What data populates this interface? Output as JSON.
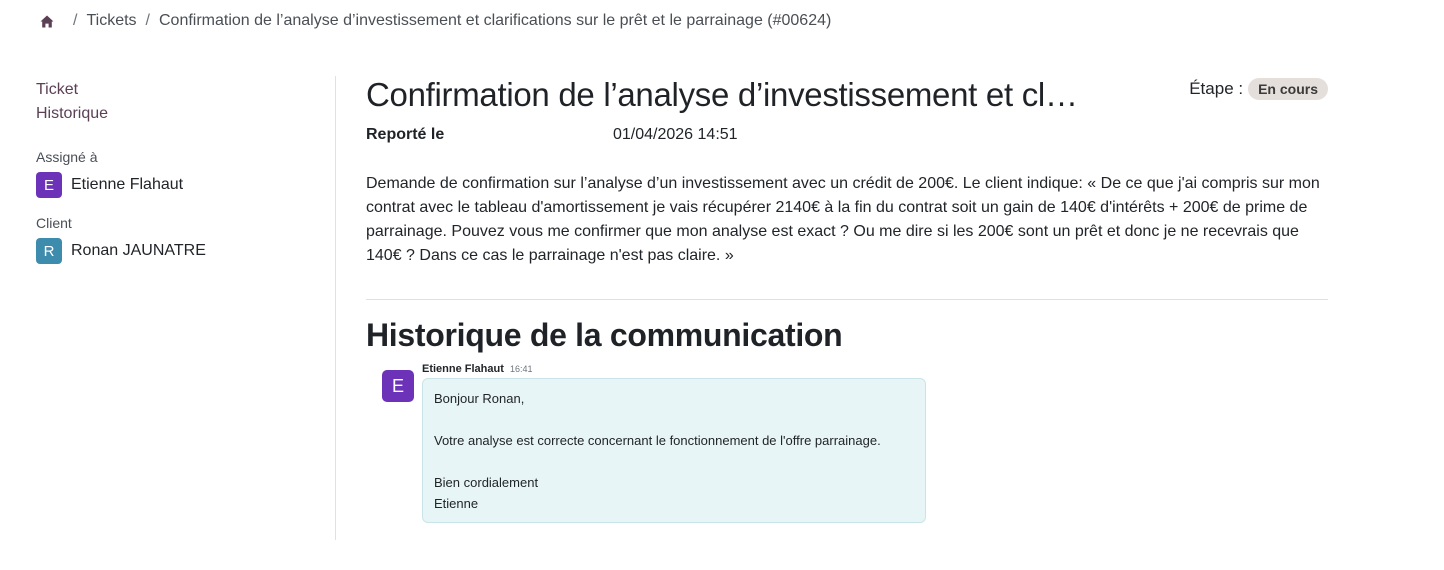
{
  "breadcrumb": {
    "home_icon": "home-icon",
    "separator": "/",
    "tickets": "Tickets",
    "current": "Confirmation de l’analyse d’investissement et clarifications sur le prêt et le parrainage (#00624)"
  },
  "sidebar": {
    "nav": [
      "Ticket",
      "Historique"
    ],
    "assigned_label": "Assigné à",
    "assigned": {
      "initial": "E",
      "name": "Etienne Flahaut"
    },
    "client_label": "Client",
    "client": {
      "initial": "R",
      "name": "Ronan JAUNATRE"
    }
  },
  "ticket": {
    "title": "Confirmation de l’analyse d’investissement et clarifications sur le prêt et le parrainage",
    "stage_label": "Étape :",
    "stage": "En cours",
    "reported_label": "Reporté le",
    "reported_value": "01/04/2026 14:51",
    "description": "Demande de confirmation sur l’analyse d’un investissement avec un crédit de 200€. Le client indique: « De ce que j'ai compris sur mon contrat avec le tableau d'amortissement je vais récupérer 2140€ à la fin du contrat soit un gain   de 140€ d'intérêts + 200€ de prime de parrainage. Pouvez vous me confirmer que mon analyse est exact ? Ou me dire si les 200€ sont un prêt et donc je ne recevrais que 140€ ? Dans ce cas le parrainage n'est pas claire. »"
  },
  "history": {
    "title": "Historique de la communication",
    "messages": [
      {
        "initial": "E",
        "author": "Etienne Flahaut",
        "time": "16:41",
        "lines": {
          "greeting": "Bonjour Ronan,",
          "body": "Votre analyse est correcte concernant le fonctionnement de l'offre parrainage.",
          "closing": "Bien cordialement",
          "signature": "Etienne"
        }
      }
    ]
  },
  "colors": {
    "avatar_purple": "#6c33b8",
    "avatar_teal": "#3d8bad",
    "bubble_bg": "#e8f5f6",
    "stage_badge_bg": "#e5dfdc"
  }
}
